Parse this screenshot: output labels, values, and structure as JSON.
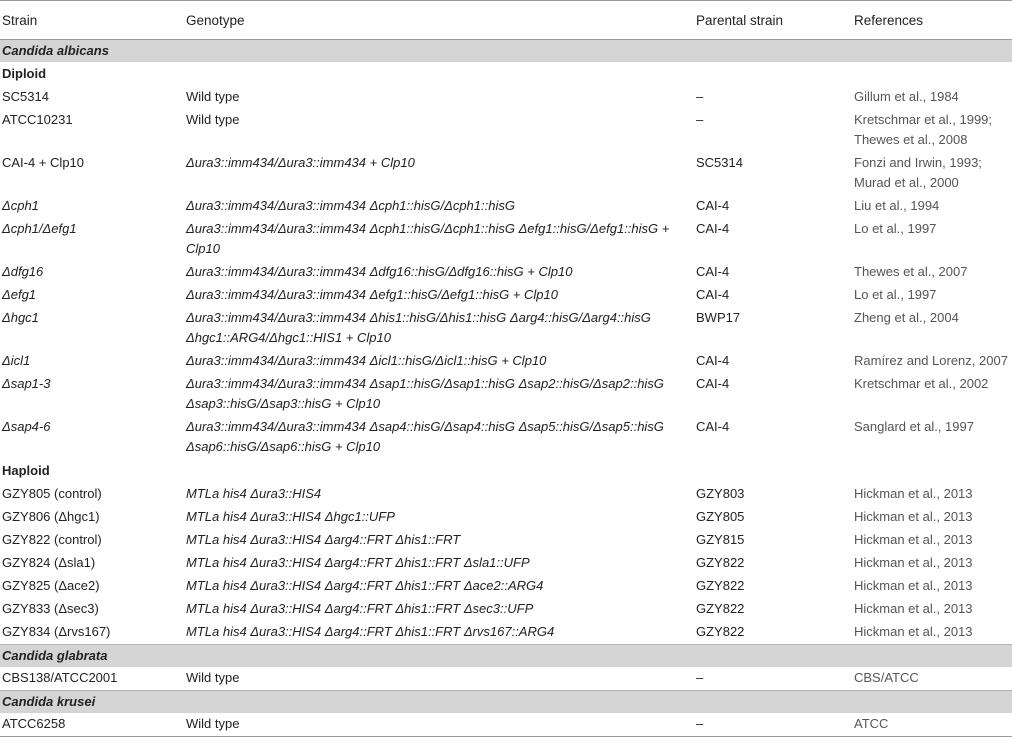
{
  "headers": {
    "strain": "Strain",
    "genotype": "Genotype",
    "parental": "Parental strain",
    "references": "References"
  },
  "sections": [
    {
      "species": "Candida albicans",
      "groups": [
        {
          "label": "Diploid",
          "rows": [
            {
              "strain": "SC5314",
              "genotype": "Wild type",
              "parental": "–",
              "ref": "Gillum et al., 1984"
            },
            {
              "strain": "ATCC10231",
              "genotype": "Wild type",
              "parental": "–",
              "ref": "Kretschmar et al., 1999; Thewes et al., 2008"
            },
            {
              "strain": "CAI-4 + Clp10",
              "genotype": "Δura3::imm434/Δura3::imm434 + Clp10",
              "parental": "SC5314",
              "ref": "Fonzi and Irwin, 1993; Murad et al., 2000"
            },
            {
              "strain": "Δcph1",
              "genotype": "Δura3::imm434/Δura3::imm434 Δcph1::hisG/Δcph1::hisG",
              "parental": "CAI-4",
              "ref": "Liu et al., 1994"
            },
            {
              "strain": "Δcph1/Δefg1",
              "genotype": "Δura3::imm434/Δura3::imm434 Δcph1::hisG/Δcph1::hisG Δefg1::hisG/Δefg1::hisG + Clp10",
              "parental": "CAI-4",
              "ref": "Lo et al., 1997"
            },
            {
              "strain": "Δdfg16",
              "genotype": "Δura3::imm434/Δura3::imm434 Δdfg16::hisG/Δdfg16::hisG + Clp10",
              "parental": "CAI-4",
              "ref": "Thewes et al., 2007"
            },
            {
              "strain": "Δefg1",
              "genotype": "Δura3::imm434/Δura3::imm434 Δefg1::hisG/Δefg1::hisG + Clp10",
              "parental": "CAI-4",
              "ref": "Lo et al., 1997"
            },
            {
              "strain": "Δhgc1",
              "genotype": "Δura3::imm434/Δura3::imm434 Δhis1::hisG/Δhis1::hisG Δarg4::hisG/Δarg4::hisG Δhgc1::ARG4/Δhgc1::HIS1 + Clp10",
              "parental": "BWP17",
              "ref": "Zheng et al., 2004"
            },
            {
              "strain": "Δicl1",
              "genotype": "Δura3::imm434/Δura3::imm434 Δicl1::hisG/Δicl1::hisG + Clp10",
              "parental": "CAI-4",
              "ref": "Ramírez and Lorenz, 2007"
            },
            {
              "strain": "Δsap1-3",
              "genotype": "Δura3::imm434/Δura3::imm434 Δsap1::hisG/Δsap1::hisG Δsap2::hisG/Δsap2::hisG Δsap3::hisG/Δsap3::hisG + Clp10",
              "parental": "CAI-4",
              "ref": "Kretschmar et al., 2002"
            },
            {
              "strain": "Δsap4-6",
              "genotype": "Δura3::imm434/Δura3::imm434 Δsap4::hisG/Δsap4::hisG Δsap5::hisG/Δsap5::hisG Δsap6::hisG/Δsap6::hisG + Clp10",
              "parental": "CAI-4",
              "ref": "Sanglard et al., 1997"
            }
          ]
        },
        {
          "label": "Haploid",
          "rows": [
            {
              "strain": "GZY805 (control)",
              "genotype": "MTLa his4 Δura3::HIS4",
              "parental": "GZY803",
              "ref": "Hickman et al., 2013"
            },
            {
              "strain": "GZY806 (Δhgc1)",
              "genotype": "MTLa his4 Δura3::HIS4 Δhgc1::UFP",
              "parental": "GZY805",
              "ref": "Hickman et al., 2013"
            },
            {
              "strain": "GZY822 (control)",
              "genotype": "MTLa his4 Δura3::HIS4 Δarg4::FRT Δhis1::FRT",
              "parental": "GZY815",
              "ref": "Hickman et al., 2013"
            },
            {
              "strain": "GZY824 (Δsla1)",
              "genotype": "MTLa his4 Δura3::HIS4 Δarg4::FRT Δhis1::FRT Δsla1::UFP",
              "parental": "GZY822",
              "ref": "Hickman et al., 2013"
            },
            {
              "strain": "GZY825 (Δace2)",
              "genotype": "MTLa his4 Δura3::HIS4 Δarg4::FRT Δhis1::FRT Δace2::ARG4",
              "parental": "GZY822",
              "ref": "Hickman et al., 2013"
            },
            {
              "strain": "GZY833 (Δsec3)",
              "genotype": "MTLa his4 Δura3::HIS4 Δarg4::FRT Δhis1::FRT Δsec3::UFP",
              "parental": "GZY822",
              "ref": "Hickman et al., 2013"
            },
            {
              "strain": "GZY834 (Δrvs167)",
              "genotype": "MTLa his4 Δura3::HIS4 Δarg4::FRT Δhis1::FRT Δrvs167::ARG4",
              "parental": "GZY822",
              "ref": "Hickman et al., 2013"
            }
          ]
        }
      ]
    },
    {
      "species": "Candida glabrata",
      "groups": [
        {
          "label": "",
          "rows": [
            {
              "strain": "CBS138/ATCC2001",
              "genotype": "Wild type",
              "parental": "–",
              "ref": "CBS/ATCC"
            }
          ]
        }
      ]
    },
    {
      "species": "Candida krusei",
      "groups": [
        {
          "label": "",
          "rows": [
            {
              "strain": "ATCC6258",
              "genotype": "Wild type",
              "parental": "–",
              "ref": "ATCC"
            }
          ]
        }
      ]
    }
  ]
}
